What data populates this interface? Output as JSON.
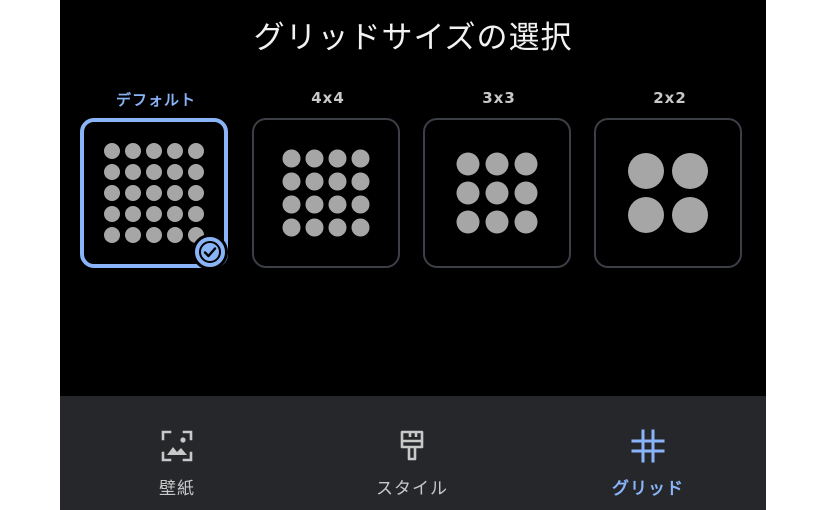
{
  "header": {
    "title": "グリッドサイズの選択"
  },
  "options": [
    {
      "label": "デフォルト",
      "selected": true,
      "grid": 5
    },
    {
      "label": "4x4",
      "selected": false,
      "grid": 4
    },
    {
      "label": "3x3",
      "selected": false,
      "grid": 3
    },
    {
      "label": "2x2",
      "selected": false,
      "grid": 2
    }
  ],
  "nav": {
    "items": [
      {
        "label": "壁紙",
        "icon": "wallpaper-icon",
        "active": false
      },
      {
        "label": "スタイル",
        "icon": "brush-icon",
        "active": false
      },
      {
        "label": "グリッド",
        "icon": "grid-icon",
        "active": true
      }
    ]
  },
  "colors": {
    "accent": "#8ab4f8",
    "background": "#000000",
    "nav_background": "#25272b",
    "dot": "#a6a6a6"
  }
}
